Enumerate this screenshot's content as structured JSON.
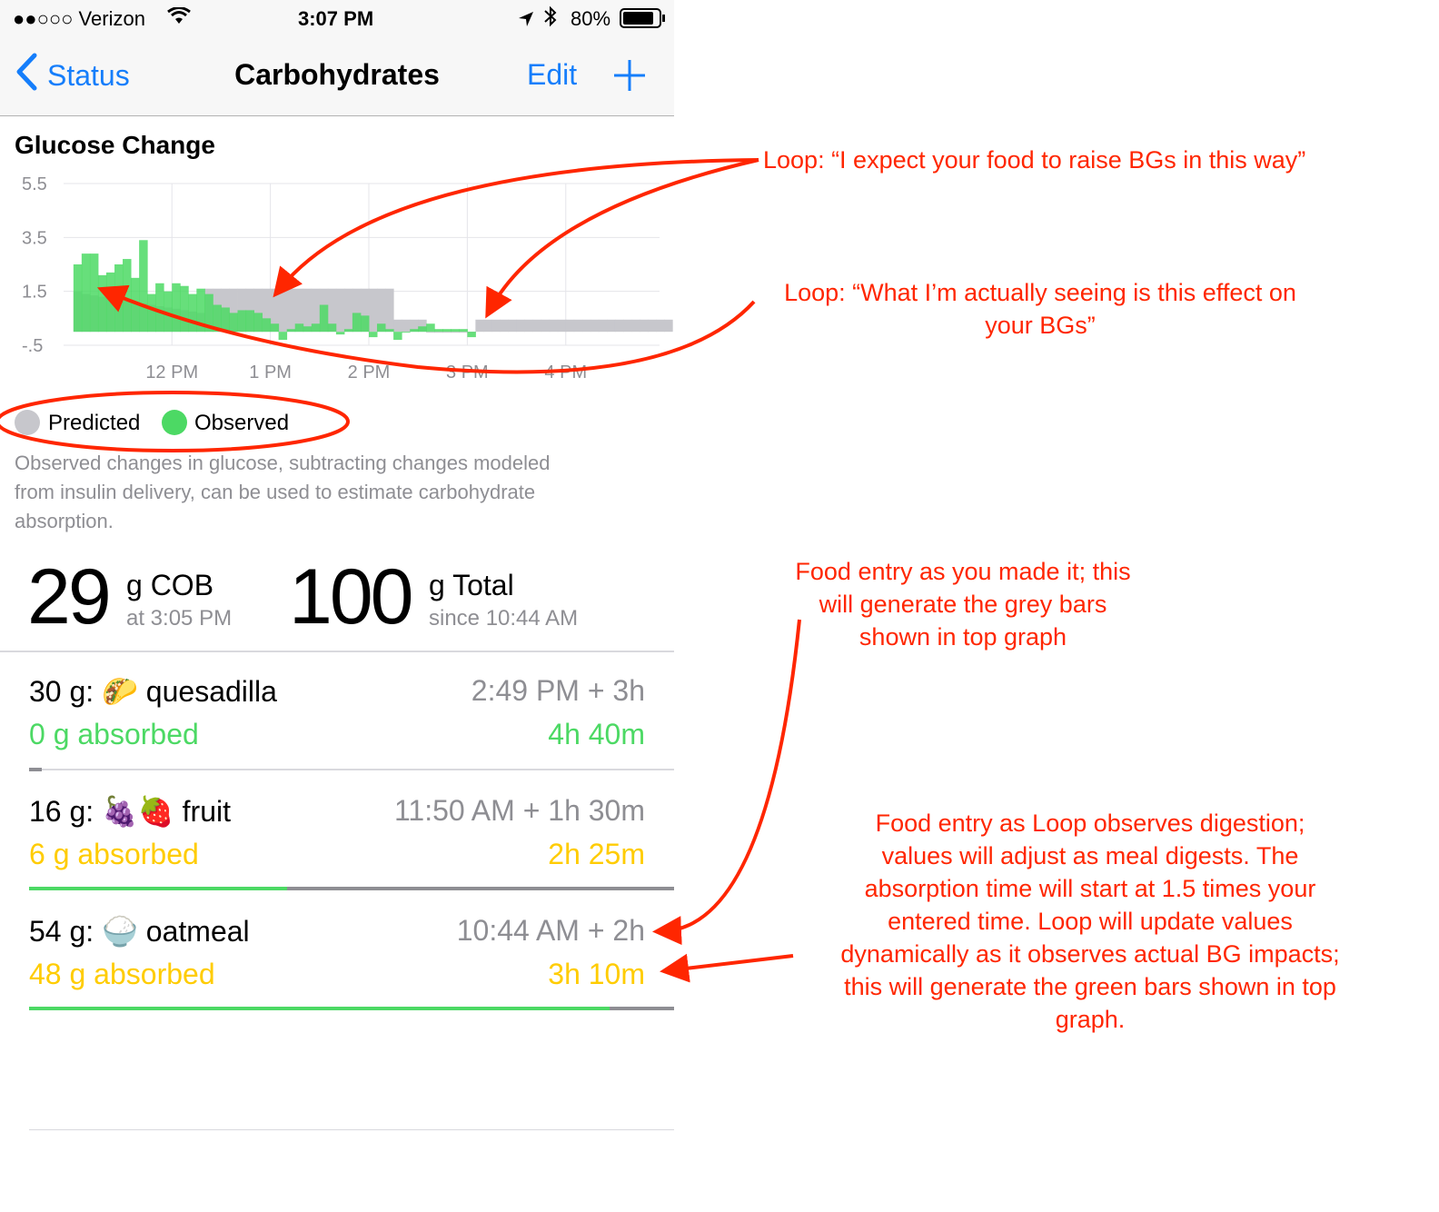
{
  "status_bar": {
    "carrier": "●●○○○ Verizon",
    "time": "3:07 PM",
    "battery": "80%"
  },
  "nav": {
    "back_label": "Status",
    "title": "Carbohydrates",
    "edit_label": "Edit",
    "add_icon": "plus-icon"
  },
  "chart": {
    "title": "Glucose Change",
    "legend": {
      "predicted": "Predicted",
      "observed": "Observed"
    },
    "description": [
      "Observed changes in glucose, subtracting changes modeled",
      "from insulin delivery, can be used to estimate carbohydrate",
      "absorption."
    ]
  },
  "chart_data": {
    "type": "bar",
    "title": "Glucose Change",
    "y_ticks": [
      "5.5",
      "3.5",
      "1.5",
      "-.5"
    ],
    "x_ticks": [
      "12 PM",
      "1 PM",
      "2 PM",
      "3 PM",
      "4 PM"
    ],
    "ylim": [
      -0.5,
      5.5
    ],
    "xlim": [
      10.9,
      17.1
    ],
    "grid": true,
    "legend_position": "bottom-left",
    "bar_width_hours": 0.083,
    "series": [
      {
        "name": "Predicted",
        "color": "#c7c7cc",
        "x": [
          11.0,
          11.083,
          11.167,
          11.25,
          11.333,
          11.417,
          11.5,
          11.583,
          11.667,
          11.75,
          11.833,
          11.917,
          12.0,
          12.083,
          12.167,
          12.25,
          12.333,
          12.417,
          12.5,
          12.583,
          12.667,
          12.75,
          12.833,
          12.917,
          13.0,
          13.083,
          13.167,
          13.25,
          13.333,
          13.417,
          13.5,
          13.583,
          13.667,
          13.75,
          13.833,
          13.917,
          14.0,
          14.083,
          14.167,
          14.25,
          14.333,
          14.417,
          14.5,
          14.583,
          14.667,
          14.75,
          14.833,
          14.917,
          15.0,
          15.083,
          15.167,
          15.25,
          15.333,
          15.417,
          15.5,
          15.583,
          15.667,
          15.75,
          15.833,
          15.917,
          16.0,
          16.083,
          16.167,
          16.25,
          16.333,
          16.417,
          16.5,
          16.583,
          16.667,
          16.75,
          16.833,
          16.917,
          17.0
        ],
        "values": [
          1.5,
          1.4,
          1.35,
          1.3,
          1.25,
          1.2,
          1.15,
          1.1,
          1.05,
          1.0,
          0.95,
          0.9,
          0.85,
          0.8,
          0.75,
          0.7,
          1.6,
          1.6,
          1.6,
          1.6,
          1.6,
          1.6,
          1.6,
          1.6,
          1.6,
          1.6,
          1.6,
          1.6,
          1.6,
          1.6,
          1.6,
          1.6,
          1.6,
          1.6,
          1.6,
          1.6,
          1.6,
          1.6,
          1.6,
          0.45,
          0.45,
          0.45,
          0.45,
          0.0,
          0.0,
          0.0,
          0.0,
          0.0,
          0.0,
          0.45,
          0.45,
          0.45,
          0.45,
          0.45,
          0.45,
          0.45,
          0.45,
          0.45,
          0.45,
          0.45,
          0.45,
          0.45,
          0.45,
          0.45,
          0.45,
          0.45,
          0.45,
          0.45,
          0.45,
          0.45,
          0.45,
          0.45,
          0.45
        ]
      },
      {
        "name": "Observed",
        "color": "#4cd964",
        "x": [
          11.0,
          11.083,
          11.167,
          11.25,
          11.333,
          11.417,
          11.5,
          11.583,
          11.667,
          11.75,
          11.833,
          11.917,
          12.0,
          12.083,
          12.167,
          12.25,
          12.333,
          12.417,
          12.5,
          12.583,
          12.667,
          12.75,
          12.833,
          12.917,
          13.0,
          13.083,
          13.167,
          13.25,
          13.333,
          13.417,
          13.5,
          13.583,
          13.667,
          13.75,
          13.833,
          13.917,
          14.0,
          14.083,
          14.167,
          14.25,
          14.333,
          14.417,
          14.5,
          14.583,
          14.667,
          14.75,
          14.833,
          14.917,
          15.0
        ],
        "values": [
          2.5,
          2.9,
          2.9,
          2.1,
          2.2,
          2.5,
          2.7,
          2.0,
          3.4,
          1.4,
          1.8,
          1.5,
          1.8,
          1.7,
          1.4,
          1.6,
          1.4,
          1.0,
          0.9,
          0.7,
          0.8,
          0.8,
          0.7,
          0.5,
          0.3,
          -0.3,
          0.1,
          0.3,
          0.2,
          0.3,
          1.0,
          0.3,
          -0.1,
          0.1,
          0.7,
          0.6,
          -0.2,
          0.3,
          0.1,
          -0.3,
          0.0,
          0.1,
          0.2,
          0.3,
          0.1,
          0.1,
          0.1,
          0.1,
          -0.2
        ]
      }
    ]
  },
  "summary": {
    "cob_value": "29",
    "cob_unit": "g COB",
    "cob_time": "at 3:05 PM",
    "total_value": "100",
    "total_unit": "g Total",
    "total_since": "since 10:44 AM"
  },
  "entries": [
    {
      "title": "30 g:",
      "emoji": "🌮",
      "food": "quesadilla",
      "time": "2:49 PM + 3h",
      "absorbed": "0 g absorbed",
      "remaining": "4h 40m",
      "color": "#4cd964",
      "progress": 0.02
    },
    {
      "title": "16 g:",
      "emoji": "🍇🍓",
      "food": "fruit",
      "time": "11:50 AM + 1h 30m",
      "absorbed": "6 g absorbed",
      "remaining": "2h 25m",
      "color": "#ffcc00",
      "progress": 0.4
    },
    {
      "title": "54 g:",
      "emoji": "🍚",
      "food": "oatmeal",
      "time": "10:44 AM + 2h",
      "absorbed": "48 g absorbed",
      "remaining": "3h 10m",
      "color": "#ffcc00",
      "progress": 0.9
    }
  ],
  "annotations": {
    "a1": "Loop:  “I expect your food to raise BGs in this way”",
    "a2_line1": "Loop:  “What I’m actually seeing is this effect on",
    "a2_line2": "your BGs”",
    "a3_line1": "Food entry as you made it; this",
    "a3_line2": "will generate the grey bars",
    "a3_line3": "shown in top graph",
    "a4_line1": "Food entry as Loop observes digestion;",
    "a4_line2": "values will adjust as meal digests.  The",
    "a4_line3": "absorption time will start at 1.5 times your",
    "a4_line4": "entered time.  Loop will update values",
    "a4_line5": "dynamically as it observes actual BG impacts;",
    "a4_line6": "this will generate the green bars shown in top",
    "a4_line7": "graph."
  }
}
